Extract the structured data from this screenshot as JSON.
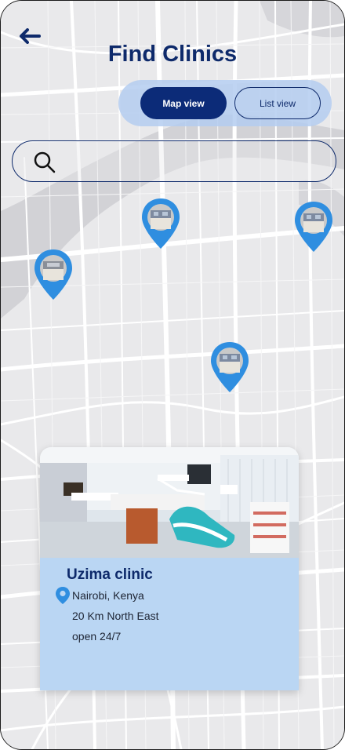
{
  "header": {
    "title": "Find Clinics"
  },
  "view_toggle": {
    "map_label": "Map view",
    "list_label": "List view",
    "selected": "Map view"
  },
  "search": {
    "value": "",
    "placeholder": ""
  },
  "colors": {
    "primary": "#0c2b78",
    "pin": "#2f8ee0",
    "card_body": "#bad6f3",
    "map_bg": "#e9e9eb"
  },
  "icons": [
    "back-arrow-icon",
    "search-icon",
    "location-pin-icon",
    "map-marker-icon"
  ],
  "clinic_card": {
    "name": "Uzima clinic",
    "location": "Nairobi, Kenya",
    "distance": "20 Km North East",
    "hours": "open 24/7"
  }
}
